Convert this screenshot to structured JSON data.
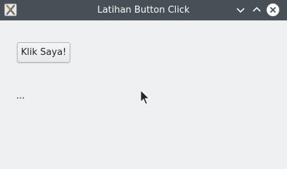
{
  "window": {
    "title": "Latihan Button Click",
    "app_icon": "x-tool-icon",
    "controls": {
      "minimize_icon": "chevron-down-icon",
      "maximize_icon": "chevron-up-icon",
      "close_icon": "close-icon"
    }
  },
  "main": {
    "button_label": "Klik Saya!",
    "output_label": "..."
  },
  "colors": {
    "titlebar": "#475057",
    "background": "#eff0f1",
    "text": "#232627"
  }
}
